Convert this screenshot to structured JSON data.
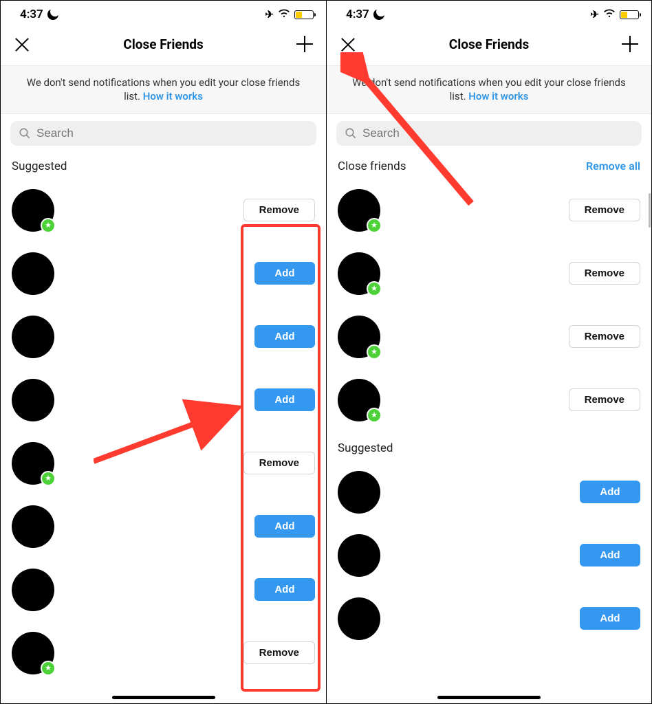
{
  "status": {
    "time": "4:37"
  },
  "header": {
    "title": "Close Friends"
  },
  "banner": {
    "text": "We don't send notifications when you edit your close friends list.",
    "link": "How it works"
  },
  "search": {
    "placeholder": "Search"
  },
  "labels": {
    "suggested": "Suggested",
    "closeFriends": "Close friends",
    "removeAll": "Remove all",
    "add": "Add",
    "remove": "Remove"
  },
  "left": {
    "rows": [
      {
        "star": true,
        "action": "remove"
      },
      {
        "star": false,
        "action": "add"
      },
      {
        "star": false,
        "action": "add"
      },
      {
        "star": false,
        "action": "add"
      },
      {
        "star": true,
        "action": "remove"
      },
      {
        "star": false,
        "action": "add"
      },
      {
        "star": false,
        "action": "add"
      },
      {
        "star": true,
        "action": "remove"
      }
    ]
  },
  "right": {
    "closeFriends": [
      {
        "star": true
      },
      {
        "star": true
      },
      {
        "star": true
      },
      {
        "star": true
      }
    ],
    "suggested": [
      {},
      {},
      {}
    ]
  }
}
